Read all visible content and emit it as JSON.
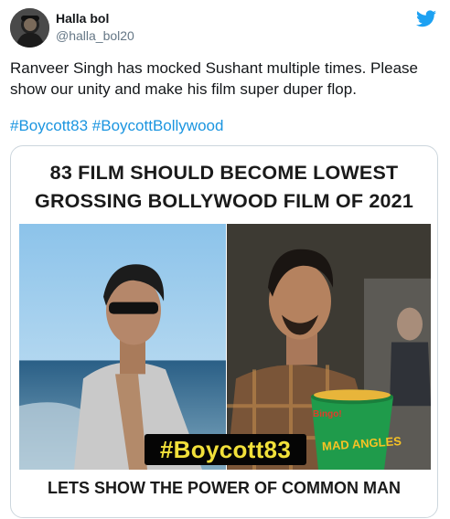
{
  "author": {
    "name": "Halla bol",
    "handle": "@halla_bol20"
  },
  "tweet": {
    "text": "Ranveer Singh has mocked Sushant multiple times. Please show our unity and make his film super duper flop.",
    "hashtags": [
      "#Boycott83",
      "#BoycottBollywood"
    ]
  },
  "image": {
    "headline_line1": "83 FILM SHOULD BECOME LOWEST",
    "headline_line2": "GROSSING BOLLYWOOD FILM OF 2021",
    "tag": "#Boycott83",
    "footer": "LETS SHOW THE POWER OF COMMON MAN",
    "snack_brand": "MAD ANGLES",
    "snack_badge": "Bingo!"
  },
  "colors": {
    "link": "#1b95e0",
    "twitter_blue": "#1da1f2",
    "tag_text": "#f1e03a",
    "handle_gray": "#657786"
  },
  "icons": {
    "brand": "twitter-bird-icon"
  }
}
